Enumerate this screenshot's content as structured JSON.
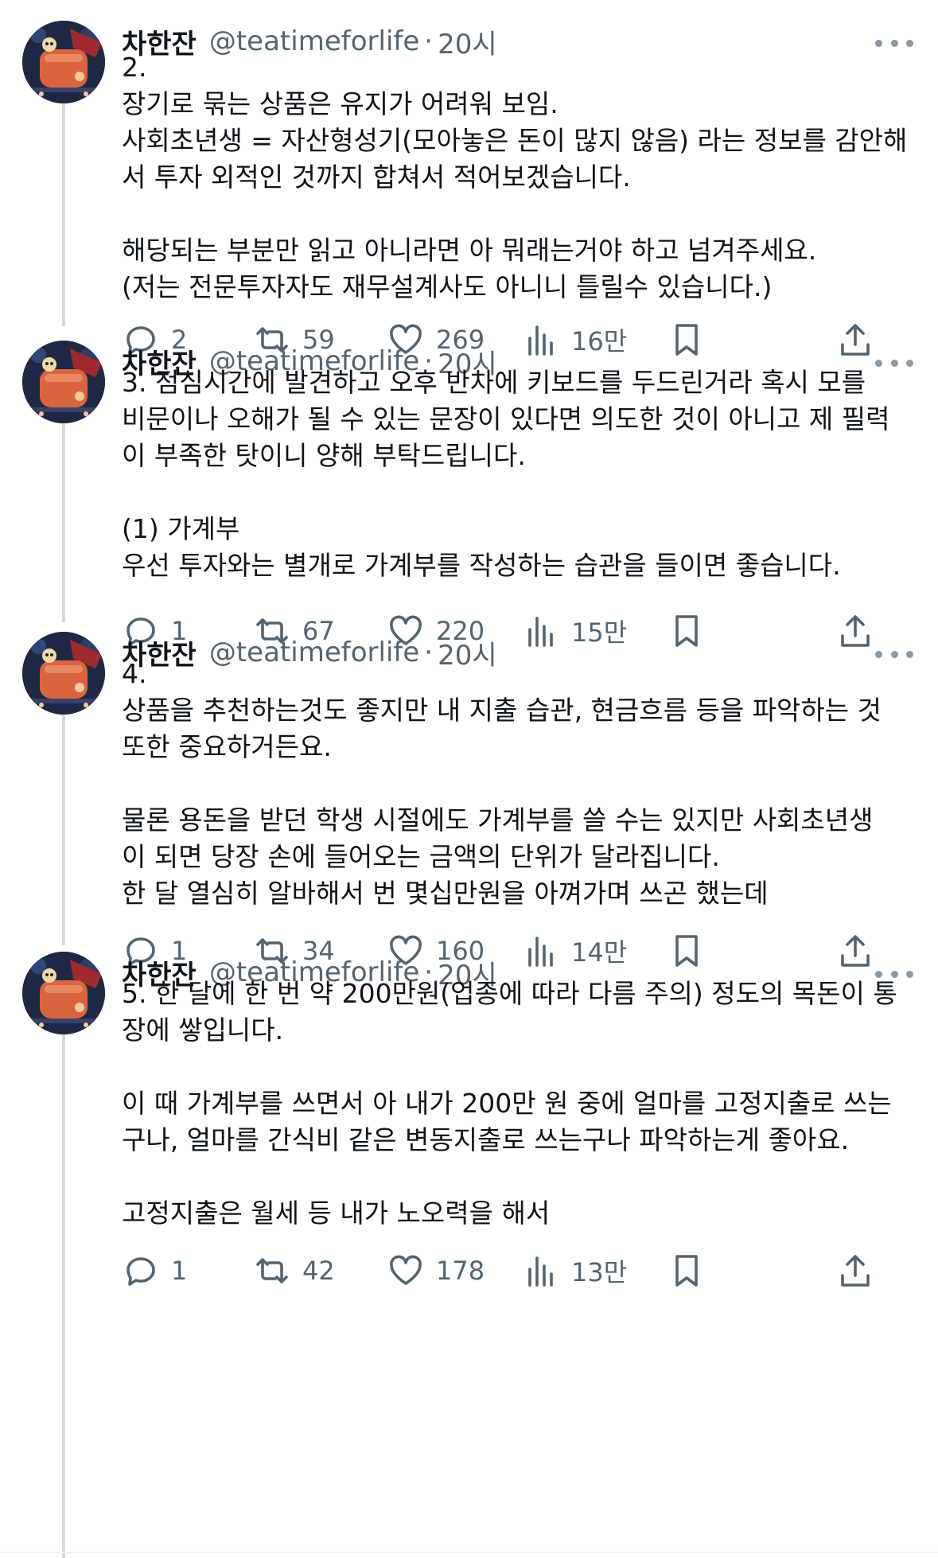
{
  "tweets": [
    {
      "name": "차한잔",
      "handle": "@teatimeforlife",
      "sep": "·",
      "time": "20시",
      "lines": [
        "2.",
        "장기로 묶는 상품은 유지가 어려워 보임.",
        "사회초년생 = 자산형성기(모아놓은 돈이 많지 않음) 라는 정보를 감안해",
        "서 투자 외적인 것까지 합쳐서 적어보겠습니다.",
        "",
        "해당되는 부분만 읽고 아니라면 아 뭐래는거야 하고 넘겨주세요.",
        "(저는 전문투자자도 재무설계사도 아니니 틀릴수 있습니다.)"
      ],
      "replies": "2",
      "retweets": "59",
      "likes": "269",
      "views": "16만"
    },
    {
      "name": "차한잔",
      "handle": "@teatimeforlife",
      "sep": "·",
      "time": "20시",
      "lines": [
        "3. 점심시간에 발견하고 오후 반차에 키보드를 두드린거라 혹시 모를",
        "비문이나 오해가 될 수 있는 문장이 있다면 의도한 것이 아니고 제 필력",
        "이 부족한 탓이니 양해 부탁드립니다.",
        "",
        "(1) 가계부",
        "우선 투자와는 별개로 가계부를 작성하는 습관을 들이면 좋습니다."
      ],
      "replies": "1",
      "retweets": "67",
      "likes": "220",
      "views": "15만"
    },
    {
      "name": "차한잔",
      "handle": "@teatimeforlife",
      "sep": "·",
      "time": "20시",
      "lines": [
        "4.",
        "상품을 추천하는것도 좋지만 내 지출 습관, 현금흐름 등을 파악하는 것",
        "또한 중요하거든요.",
        "",
        "물론 용돈을 받던 학생 시절에도 가계부를 쓸 수는 있지만 사회초년생",
        "이 되면 당장 손에 들어오는 금액의 단위가 달라집니다.",
        "한 달 열심히 알바해서 번 몇십만원을 아껴가며 쓰곤 했는데"
      ],
      "replies": "1",
      "retweets": "34",
      "likes": "160",
      "views": "14만"
    },
    {
      "name": "차한잔",
      "handle": "@teatimeforlife",
      "sep": "·",
      "time": "20시",
      "lines": [
        "5. 한 달에 한 번 약 200만원(업종에 따라 다름 주의) 정도의 목돈이 통",
        "장에 쌓입니다.",
        "",
        "이 때 가계부를 쓰면서 아 내가 200만 원 중에 얼마를 고정지출로 쓰는",
        "구나, 얼마를 간식비 같은 변동지출로 쓰는구나 파악하는게 좋아요.",
        "",
        "고정지출은 월세 등 내가 노오력을 해서"
      ],
      "replies": "1",
      "retweets": "42",
      "likes": "178",
      "views": "13만"
    }
  ],
  "icons": {
    "reply": "speech-bubble-icon",
    "retweet": "retweet-icon",
    "like": "heart-icon",
    "views": "bar-chart-icon",
    "bookmark": "bookmark-icon",
    "share": "share-icon",
    "more": "more-dots-icon"
  },
  "colors": {
    "text": "#0f1419",
    "secondary": "#536471",
    "thread_line": "#cfd9de"
  }
}
